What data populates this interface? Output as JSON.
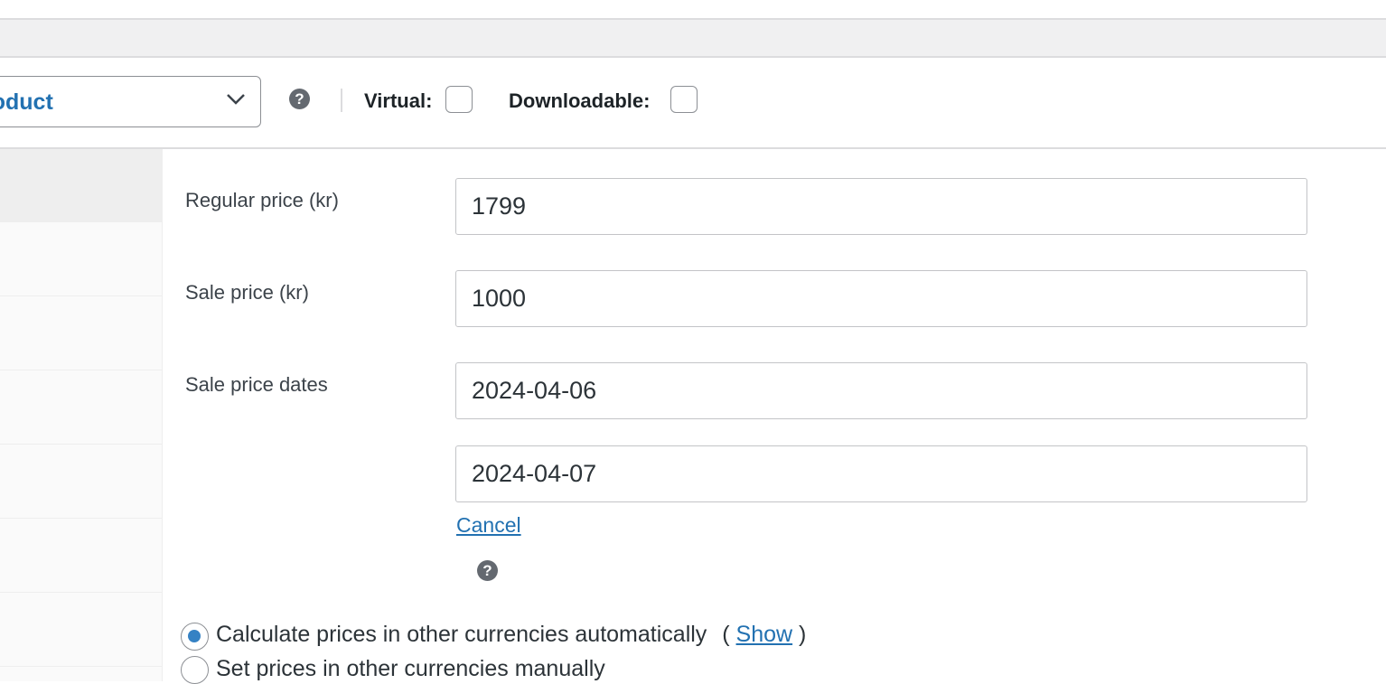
{
  "product_data": {
    "product_type_value": "Simple product",
    "product_type_visible": "roduct",
    "virtual_label": "Virtual:",
    "downloadable_label": "Downloadable:"
  },
  "general": {
    "regular_price_label": "Regular price (kr)",
    "regular_price_value": "1799",
    "sale_price_label": "Sale price (kr)",
    "sale_price_value": "1000",
    "sale_dates_label": "Sale price dates",
    "sale_date_from": "2024-04-06",
    "sale_date_to": "2024-04-07",
    "cancel_label": "Cancel"
  },
  "currency": {
    "auto_label": "Calculate prices in other currencies automatically",
    "open_paren": "(",
    "show_label": "Show",
    "close_paren": ")",
    "manual_label": "Set prices in other currencies manually",
    "selected": "auto"
  },
  "icons": {
    "help": "?",
    "accent_color": "#2271b1",
    "radio_checked_color": "#3582c4"
  }
}
